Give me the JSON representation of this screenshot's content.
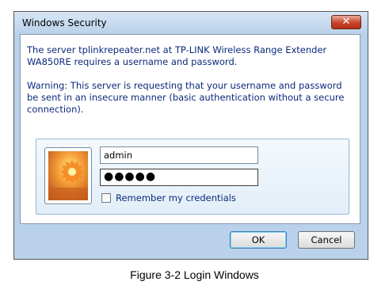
{
  "window": {
    "title": "Windows Security",
    "close_label": "✕"
  },
  "message": {
    "line1": "The server tplinkrepeater.net at TP-LINK Wireless Range Extender",
    "line2": "WA850RE requires a username and password.",
    "warning": "Warning: This server is requesting that your username and password be sent in an insecure manner (basic authentication without a secure connection)."
  },
  "credentials": {
    "username": "admin",
    "password_mask": "●●●●●",
    "remember_label": "Remember my credentials"
  },
  "buttons": {
    "ok": "OK",
    "cancel": "Cancel"
  },
  "caption": "Figure 3-2 Login Windows",
  "icons": {
    "avatar": "user-flower-picture-icon",
    "close": "close-icon"
  },
  "colors": {
    "text_blue": "#0d2a7c",
    "frame": "#b9d1ea",
    "close_red": "#c7442a"
  }
}
